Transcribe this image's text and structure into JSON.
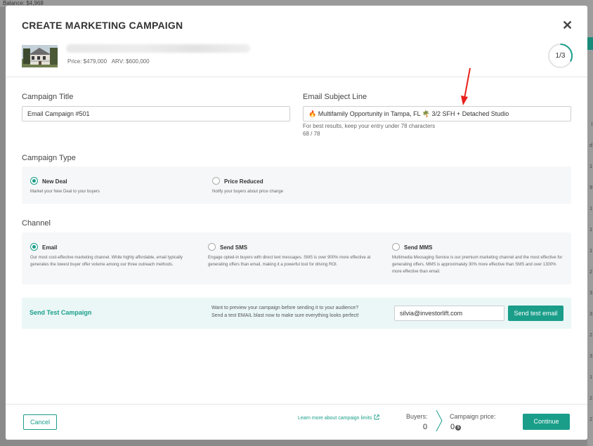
{
  "background": {
    "top_text": "Balance: $4,968",
    "right_cells": [
      "l",
      "d",
      "1",
      "9",
      "1",
      "1",
      "1",
      "2",
      "3",
      "3",
      "2",
      "3",
      "1",
      "2",
      "2"
    ]
  },
  "modal": {
    "title": "CREATE MARKETING CAMPAIGN",
    "close_glyph": "✕",
    "property": {
      "price": "Price: $479,000",
      "arv": "ARV: $600,000"
    },
    "step": "1/3",
    "step_progress": 0.33
  },
  "form": {
    "campaign_title_label": "Campaign Title",
    "campaign_title_value": "Email Campaign #501",
    "subject_label": "Email Subject Line",
    "subject_value": "🔥 Multifamily Opportunity in Tampa, FL 🌴 3/2 SFH + Detached Studio",
    "subject_hint": "For best results, keep your entry under 78 characters",
    "subject_count": "68 / 78"
  },
  "campaign_type": {
    "label": "Campaign Type",
    "options": [
      {
        "title": "New Deal",
        "desc": "Market your New Deal to your buyers",
        "selected": true
      },
      {
        "title": "Price Reduced",
        "desc": "Notify your buyers about price change",
        "selected": false
      }
    ]
  },
  "channel": {
    "label": "Channel",
    "options": [
      {
        "title": "Email",
        "desc": "Our most cost-effective marketing channel. While highly affordable, email typically generates the lowest buyer offer volume among our three outreach methods.",
        "selected": true
      },
      {
        "title": "Send SMS",
        "desc": "Engage opted-in buyers with direct text messages. SMS is over 900% more effective at generating offers than email, making it a powerful tool for driving ROI.",
        "selected": false
      },
      {
        "title": "Send MMS",
        "desc": "Multimedia Messaging Service is our premium marketing channel and the most effective for generating offers. MMS is approximately 30% more effective than SMS and over 1300% more effective than email.",
        "selected": false
      }
    ]
  },
  "test": {
    "title": "Send Test Campaign",
    "desc_line1": "Want to preview your campaign before sending it to your audience?",
    "desc_line2": "Send a test EMAIL blast now to make sure everything looks perfect!",
    "email": "silvia@investorlift.com",
    "button": "Send test email"
  },
  "footer": {
    "cancel": "Cancel",
    "learn_more": "Learn more about campaign limits",
    "buyers_label": "Buyers:",
    "buyers_value": "0",
    "price_label": "Campaign price:",
    "price_value": "0"
  },
  "colors": {
    "accent": "#1a9e8a",
    "annotation_arrow": "#e8201b"
  }
}
